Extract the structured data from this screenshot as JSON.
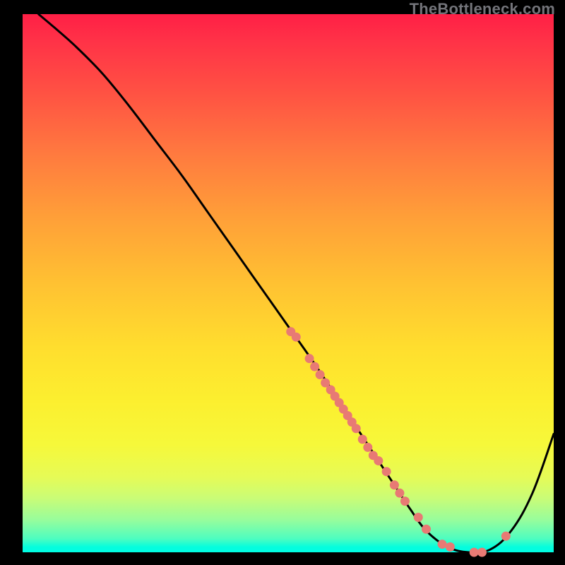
{
  "watermark": "TheBottleneck.com",
  "chart_data": {
    "type": "line",
    "title": "",
    "xlabel": "",
    "ylabel": "",
    "xlim": [
      0,
      100
    ],
    "ylim": [
      0,
      100
    ],
    "grid": false,
    "legend": false,
    "series": [
      {
        "name": "curve",
        "type": "line",
        "color": "#000000",
        "x": [
          3,
          6,
          10,
          15,
          20,
          25,
          30,
          35,
          40,
          45,
          50,
          55,
          60,
          65,
          70,
          73,
          76,
          80,
          84,
          88,
          92,
          96,
          100
        ],
        "y": [
          100,
          97.5,
          94,
          89,
          83,
          76.5,
          70,
          63,
          56,
          49,
          42,
          35,
          27.5,
          20,
          12.5,
          8,
          4,
          1,
          0,
          0.5,
          4,
          11,
          22
        ]
      },
      {
        "name": "markers",
        "type": "scatter",
        "color": "#e87a74",
        "marker_radius_px": 6.5,
        "x": [
          50.5,
          51.5,
          54,
          55,
          56,
          57,
          58,
          58.8,
          59.6,
          60.4,
          61.2,
          62,
          62.8,
          64,
          65,
          66,
          67,
          68.5,
          70,
          71,
          72,
          74.5,
          76,
          79,
          80.5,
          85,
          86.5,
          91
        ],
        "y": [
          41,
          40,
          36,
          34.5,
          33,
          31.5,
          30.2,
          29,
          27.8,
          26.6,
          25.4,
          24.2,
          23,
          21,
          19.5,
          18,
          17,
          15,
          12.5,
          11,
          9.5,
          6.5,
          4.3,
          1.5,
          1,
          0,
          0,
          3
        ]
      }
    ],
    "background_gradient": {
      "type": "vertical",
      "stops": [
        {
          "pos": 0.0,
          "color": "#ff1f46"
        },
        {
          "pos": 0.5,
          "color": "#ffc132"
        },
        {
          "pos": 0.8,
          "color": "#f6f83a"
        },
        {
          "pos": 0.97,
          "color": "#4dfdc0"
        },
        {
          "pos": 1.0,
          "color": "#00fde4"
        }
      ]
    }
  }
}
